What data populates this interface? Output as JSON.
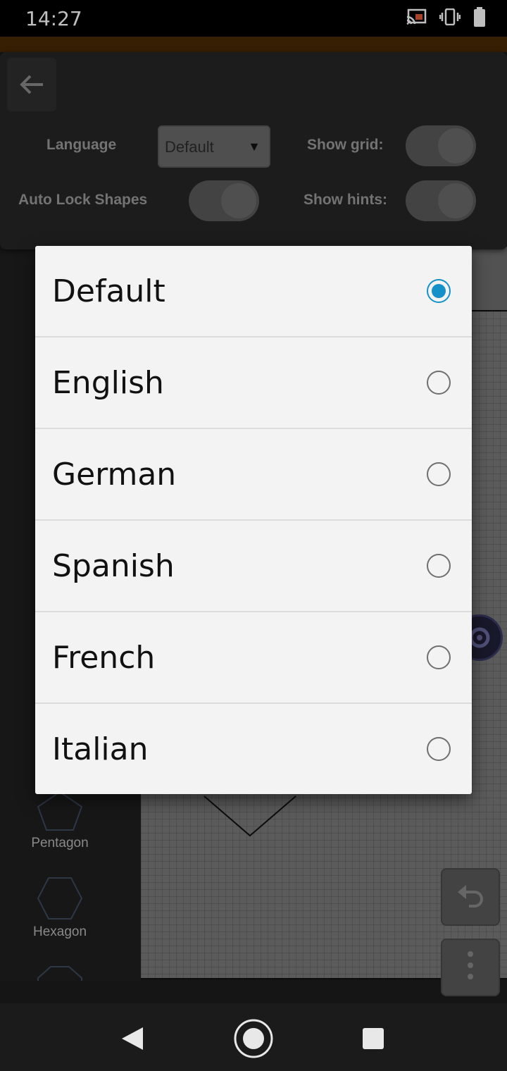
{
  "status_bar": {
    "time": "14:27",
    "icons": [
      "cast-icon",
      "vibrate-icon",
      "battery-icon"
    ]
  },
  "settings": {
    "language_label": "Language",
    "language_value": "Default",
    "show_grid_label": "Show grid:",
    "auto_lock_label": "Auto Lock Shapes",
    "show_hints_label": "Show hints:"
  },
  "shapes": [
    {
      "label": "Pentagon"
    },
    {
      "label": "Hexagon"
    }
  ],
  "dialog": {
    "options": [
      {
        "label": "Default",
        "selected": true
      },
      {
        "label": "English",
        "selected": false
      },
      {
        "label": "German",
        "selected": false
      },
      {
        "label": "Spanish",
        "selected": false
      },
      {
        "label": "French",
        "selected": false
      },
      {
        "label": "Italian",
        "selected": false
      }
    ]
  },
  "colors": {
    "accent": "#1591c9",
    "dialog_bg": "#f3f3f3",
    "panel_bg": "#262626"
  }
}
